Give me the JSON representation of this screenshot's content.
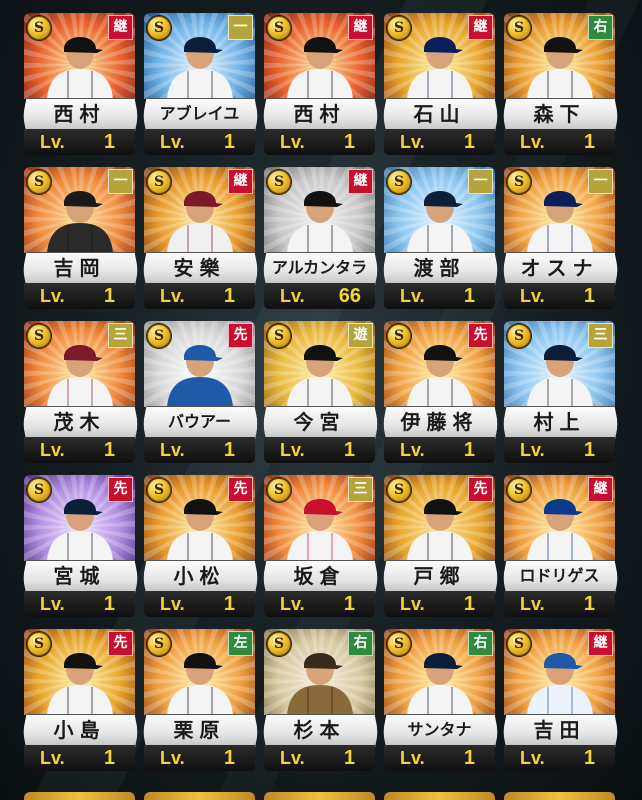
{
  "badge_colors": {
    "継": "#c8102e",
    "一": "#b5a43a",
    "右": "#2e8a3c",
    "三": "#b5a43a",
    "先": "#c8102e",
    "遊": "#b5a43a",
    "左": "#2e8a3c"
  },
  "lv_prefix": "Lv.",
  "cards": [
    {
      "name": "西村",
      "position": "継",
      "level": "1",
      "coin": "S",
      "bg": [
        "#ffe6a0",
        "#e8642c",
        "#7a1a1a"
      ],
      "uniform": "#f4f4f4",
      "cap": "#111"
    },
    {
      "name": "アブレイユ",
      "position": "一",
      "level": "1",
      "coin": "S",
      "bg": [
        "#eaf6ff",
        "#6fb3e8",
        "#1e4e86"
      ],
      "uniform": "#f4f4f4",
      "cap": "#0b1f3a"
    },
    {
      "name": "西村",
      "position": "継",
      "level": "1",
      "coin": "S",
      "bg": [
        "#ffe6a0",
        "#e8642c",
        "#7a1a1a"
      ],
      "uniform": "#f4f4f4",
      "cap": "#111"
    },
    {
      "name": "石山",
      "position": "継",
      "level": "1",
      "coin": "S",
      "bg": [
        "#fff3b0",
        "#e8a62c",
        "#8a3a10"
      ],
      "uniform": "#f4f4f4",
      "cap": "#0b1f5a"
    },
    {
      "name": "森下",
      "position": "右",
      "level": "1",
      "coin": "S",
      "bg": [
        "#fff3b0",
        "#e89a2c",
        "#7a3a10"
      ],
      "uniform": "#f4f4f4",
      "cap": "#111"
    },
    {
      "name": "吉岡",
      "position": "一",
      "level": "1",
      "coin": "S",
      "bg": [
        "#ffe6a0",
        "#f08a3c",
        "#8a2a10"
      ],
      "uniform": "#2a2a2a",
      "cap": "#1a1a1a"
    },
    {
      "name": "安樂",
      "position": "継",
      "level": "1",
      "coin": "S",
      "bg": [
        "#fff3b0",
        "#e89a2c",
        "#7a3a10"
      ],
      "uniform": "#f0f0f0",
      "cap": "#7a1a2a"
    },
    {
      "name": "アルカンタラ",
      "position": "継",
      "level": "66",
      "coin": "S",
      "bg": [
        "#f4f4f4",
        "#c8c8c8",
        "#6a6a6a"
      ],
      "uniform": "#f4f4f4",
      "cap": "#111"
    },
    {
      "name": "渡部",
      "position": "一",
      "level": "1",
      "coin": "S",
      "bg": [
        "#eaf6ff",
        "#8cc6ef",
        "#2e6ea6"
      ],
      "uniform": "#f4f4f4",
      "cap": "#0b1f3a"
    },
    {
      "name": "オスナ",
      "position": "一",
      "level": "1",
      "coin": "S",
      "bg": [
        "#fff3b0",
        "#f0a040",
        "#8a3a10"
      ],
      "uniform": "#f4f4f4",
      "cap": "#0b1f5a"
    },
    {
      "name": "茂木",
      "position": "三",
      "level": "1",
      "coin": "S",
      "bg": [
        "#fff3b0",
        "#f08a3c",
        "#8a2a10"
      ],
      "uniform": "#f4f4f4",
      "cap": "#7a1a2a"
    },
    {
      "name": "バウアー",
      "position": "先",
      "level": "1",
      "coin": "S",
      "bg": [
        "#ffffff",
        "#d8d8d8",
        "#8a8a8a"
      ],
      "uniform": "#1e5aa8",
      "cap": "#1e5aa8"
    },
    {
      "name": "今宮",
      "position": "遊",
      "level": "1",
      "coin": "S",
      "bg": [
        "#fff3b0",
        "#e8b83c",
        "#8a5a10"
      ],
      "uniform": "#f4f4f4",
      "cap": "#111"
    },
    {
      "name": "伊藤将",
      "position": "先",
      "level": "1",
      "coin": "S",
      "bg": [
        "#fff3b0",
        "#f0a040",
        "#8a3a10"
      ],
      "uniform": "#f4f4f4",
      "cap": "#111"
    },
    {
      "name": "村上",
      "position": "三",
      "level": "1",
      "coin": "S",
      "bg": [
        "#eaf6ff",
        "#8cc6ef",
        "#3a6ea6"
      ],
      "uniform": "#f4f4f4",
      "cap": "#0b1f3a"
    },
    {
      "name": "宮城",
      "position": "先",
      "level": "1",
      "coin": "S",
      "bg": [
        "#f0e6ff",
        "#b08ce0",
        "#4a2a7a"
      ],
      "uniform": "#f4f4f4",
      "cap": "#0b1f3a"
    },
    {
      "name": "小松",
      "position": "先",
      "level": "1",
      "coin": "S",
      "bg": [
        "#fff3b0",
        "#e89a2c",
        "#7a3a10"
      ],
      "uniform": "#f4f4f4",
      "cap": "#111"
    },
    {
      "name": "坂倉",
      "position": "三",
      "level": "1",
      "coin": "S",
      "bg": [
        "#fff3b0",
        "#f08a3c",
        "#8a2a10"
      ],
      "uniform": "#f4f4f4",
      "cap": "#c8102e"
    },
    {
      "name": "戸郷",
      "position": "先",
      "level": "1",
      "coin": "S",
      "bg": [
        "#ffe6a0",
        "#e8a62c",
        "#7a3a10"
      ],
      "uniform": "#f4f4f4",
      "cap": "#111"
    },
    {
      "name": "ロドリゲス",
      "position": "継",
      "level": "1",
      "coin": "S",
      "bg": [
        "#fff3b0",
        "#f0a040",
        "#8a3a10"
      ],
      "uniform": "#f4f4f4",
      "cap": "#0b3a8a"
    },
    {
      "name": "小島",
      "position": "先",
      "level": "1",
      "coin": "S",
      "bg": [
        "#fff3b0",
        "#e8a62c",
        "#8a3a10"
      ],
      "uniform": "#f4f4f4",
      "cap": "#111"
    },
    {
      "name": "栗原",
      "position": "左",
      "level": "1",
      "coin": "S",
      "bg": [
        "#fff3b0",
        "#f0a040",
        "#8a3a10"
      ],
      "uniform": "#f4f4f4",
      "cap": "#111"
    },
    {
      "name": "杉本",
      "position": "右",
      "level": "1",
      "coin": "S",
      "bg": [
        "#f4f0e0",
        "#d8c8a0",
        "#7a6a40"
      ],
      "uniform": "#8a6a3a",
      "cap": "#3a2a1a"
    },
    {
      "name": "サンタナ",
      "position": "右",
      "level": "1",
      "coin": "S",
      "bg": [
        "#fff3b0",
        "#f0a040",
        "#8a3a10"
      ],
      "uniform": "#f4f4f4",
      "cap": "#0b1f3a"
    },
    {
      "name": "吉田",
      "position": "継",
      "level": "1",
      "coin": "S",
      "bg": [
        "#fff3b0",
        "#f0a040",
        "#8a3a10"
      ],
      "uniform": "#eaf2fb",
      "cap": "#1e5aa8"
    }
  ]
}
